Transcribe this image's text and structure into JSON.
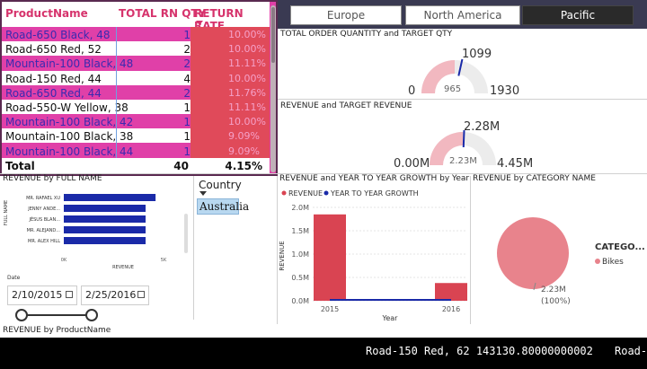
{
  "table": {
    "headers": [
      "ProductName",
      "TOTAL RN QTY",
      "RETURN RATE"
    ],
    "rows": [
      {
        "name": "Road-650 Black, 48",
        "qty": "1",
        "rate": "10.00%"
      },
      {
        "name": "Road-650 Red, 52",
        "qty": "2",
        "rate": "10.00%"
      },
      {
        "name": "Mountain-100 Black, 48",
        "qty": "2",
        "rate": "11.11%"
      },
      {
        "name": "Road-150 Red, 44",
        "qty": "4",
        "rate": "10.00%"
      },
      {
        "name": "Road-650 Red, 44",
        "qty": "2",
        "rate": "11.76%"
      },
      {
        "name": "Road-550-W Yellow, 38",
        "qty": "1",
        "rate": "11.11%"
      },
      {
        "name": "Mountain-100 Black, 42",
        "qty": "1",
        "rate": "10.00%"
      },
      {
        "name": "Mountain-100 Black, 38",
        "qty": "1",
        "rate": "9.09%"
      },
      {
        "name": "Mountain-100 Black, 44",
        "qty": "1",
        "rate": "9.09%"
      }
    ],
    "total_label": "Total",
    "total_qty": "40",
    "total_rate": "4.15%"
  },
  "tabs": [
    "Europe",
    "North America",
    "Pacific"
  ],
  "gauge1": {
    "title": "TOTAL ORDER QUANTITY and TARGET QTY",
    "min": "0",
    "max": "1930",
    "value": "965",
    "target": "1099",
    "value_num": 965,
    "max_num": 1930,
    "target_num": 1099
  },
  "gauge2": {
    "title": "REVENUE and TARGET REVENUE",
    "min": "0.00M",
    "max": "4.45M",
    "value": "2.23M",
    "target": "2.28M",
    "value_num": 2.23,
    "max_num": 4.45,
    "target_num": 2.28
  },
  "hbar": {
    "title": "REVENUE by FULL NAME",
    "ylabel": "FULL NAME",
    "xlabel": "REVENUE",
    "names": [
      "MR. RAFAEL XU",
      "JENNY ANDE...",
      "JÉSUS BLAN...",
      "MR. ALEJAND...",
      "MR. ALEX HILL"
    ],
    "values": [
      4.6,
      4.1,
      4.1,
      4.1,
      4.1
    ],
    "ticks": [
      "0K",
      "5K"
    ],
    "xmax": 5
  },
  "slicer": {
    "title": "Country",
    "selected": "Australia"
  },
  "date": {
    "label": "Date",
    "start": "2/10/2015",
    "end": "2/25/2016"
  },
  "chart_data": {
    "type": "bar",
    "title": "REVENUE and YEAR TO YEAR GROWTH by Year",
    "legend": [
      "REVENUE",
      "YEAR TO YEAR GROWTH"
    ],
    "categories": [
      "2015",
      "2016"
    ],
    "values": [
      1.85,
      0.38
    ],
    "ylabel": "REVENUE",
    "xlabel": "Year",
    "ylim": [
      0,
      2.0
    ],
    "ticks": [
      "0.0M",
      "0.5M",
      "1.0M",
      "1.5M",
      "2.0M"
    ],
    "tick_values": [
      0,
      0.5,
      1.0,
      1.5,
      2.0
    ]
  },
  "pie": {
    "title": "REVENUE by CATEGORY NAME",
    "legend_title": "CATEGO...",
    "legend_item": "Bikes",
    "label_value": "2.23M",
    "label_pct": "(100%)"
  },
  "bottom": {
    "title": "REVENUE by ProductName",
    "ticker": "Road-150 Red, 62 143130.80000000002",
    "ticker_tail": "Road-"
  },
  "colors": {
    "pink": "#e040a8",
    "red": "#d94452",
    "navy": "#1a2aa8",
    "gauge_fill": "#f2b8c0",
    "gauge_bg": "#ececec"
  }
}
